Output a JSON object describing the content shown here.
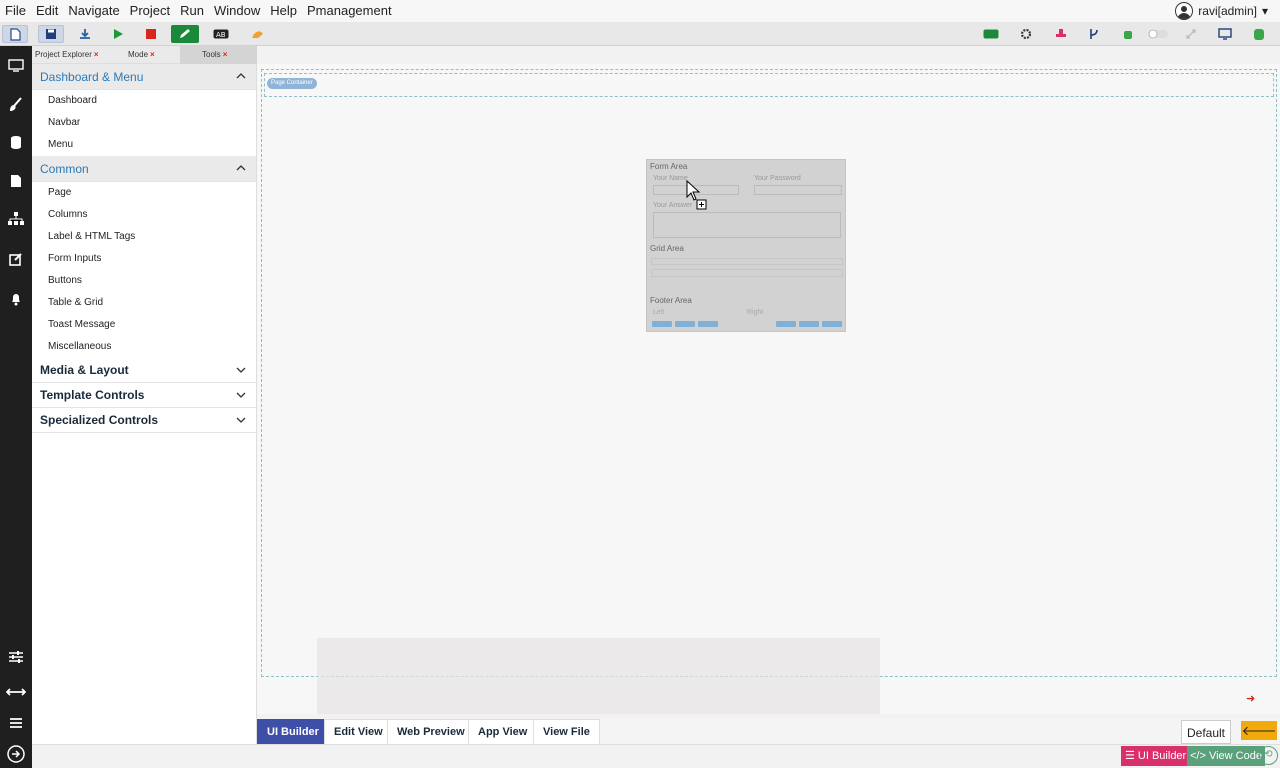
{
  "menu": [
    "File",
    "Edit",
    "Navigate",
    "Project",
    "Run",
    "Window",
    "Help",
    "Pmanagement"
  ],
  "user": {
    "name": "ravi[admin]",
    "caret": "▾"
  },
  "side_tabs": [
    {
      "label": "Project Explorer",
      "close": "×"
    },
    {
      "label": "Mode",
      "close": "×"
    },
    {
      "label": "Tools",
      "close": "×"
    }
  ],
  "sidebar": {
    "sections": [
      {
        "title": "Dashboard & Menu",
        "expanded": true,
        "items": [
          "Dashboard",
          "Navbar",
          "Menu"
        ]
      },
      {
        "title": "Common",
        "expanded": true,
        "items": [
          "Page",
          "Columns",
          "Label & HTML Tags",
          "Form Inputs",
          "Buttons",
          "Table & Grid",
          "Toast Message",
          "Miscellaneous"
        ]
      },
      {
        "title": "Media & Layout",
        "expanded": false,
        "items": []
      },
      {
        "title": "Template Controls",
        "expanded": false,
        "items": []
      },
      {
        "title": "Specialized Controls",
        "expanded": false,
        "items": []
      }
    ]
  },
  "canvas": {
    "container_badge": "Page Container"
  },
  "ghost": {
    "form_area": "Form Area",
    "your_name": "Your Name",
    "your_password": "Your Password",
    "your_answer": "Your Answer",
    "grid_area": "Grid Area",
    "footer_area": "Footer Area",
    "left": "Left",
    "right": "Right"
  },
  "bottom_tabs": [
    "UI Builder",
    "Edit View",
    "Web Preview",
    "App View",
    "View File"
  ],
  "bottom_right": {
    "default_label": "Default",
    "back_arrow": "🡐"
  },
  "status": {
    "ui_builder": "☰ UI Builder",
    "view_code": "</> View Code"
  },
  "colors": {
    "accent_blue": "#3e4fa8",
    "sidebar_link": "#2a7ab8",
    "pink": "#d9306b",
    "green": "#5aa07a",
    "orange": "#f2a90c",
    "dark": "#1f1f1f"
  }
}
